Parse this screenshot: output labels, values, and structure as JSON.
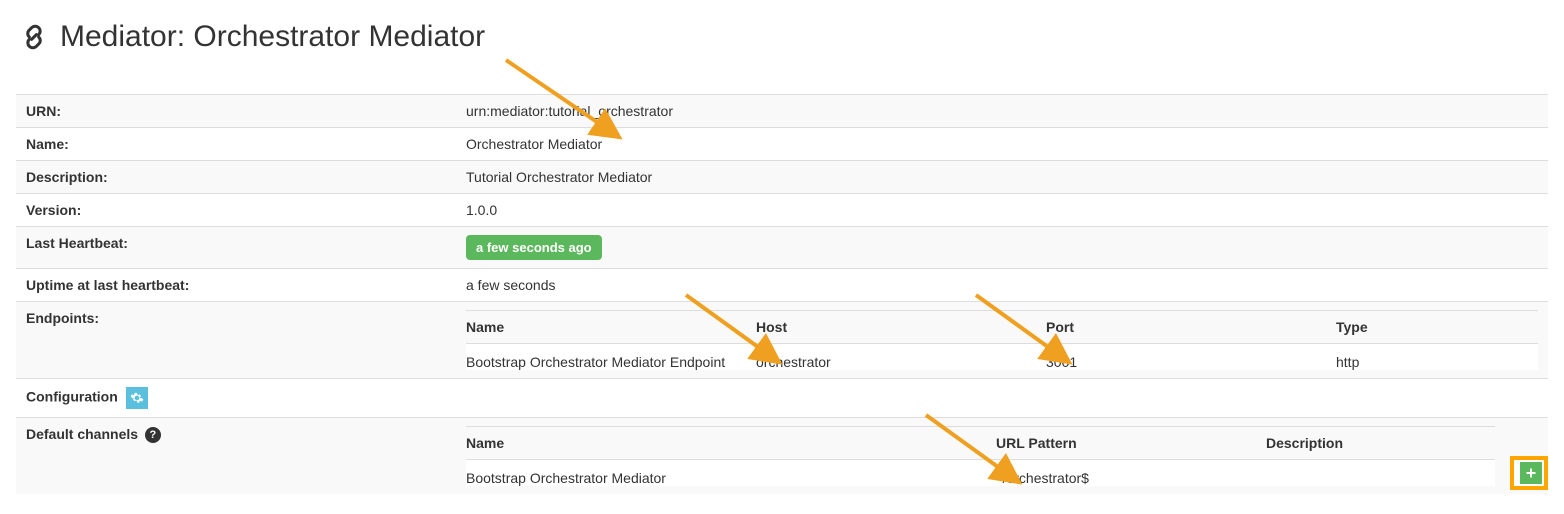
{
  "header": {
    "title": "Mediator: Orchestrator Mediator"
  },
  "labels": {
    "urn": "URN:",
    "name": "Name:",
    "description": "Description:",
    "version": "Version:",
    "lastHeartbeat": "Last Heartbeat:",
    "uptime": "Uptime at last heartbeat:",
    "endpoints": "Endpoints:",
    "configuration": "Configuration",
    "defaultChannels": "Default channels"
  },
  "values": {
    "urn": "urn:mediator:tutorial_orchestrator",
    "name": "Orchestrator Mediator",
    "description": "Tutorial Orchestrator Mediator",
    "version": "1.0.0",
    "lastHeartbeat": "a few seconds ago",
    "uptime": "a few seconds"
  },
  "endpoints": {
    "headers": {
      "name": "Name",
      "host": "Host",
      "port": "Port",
      "type": "Type"
    },
    "rows": [
      {
        "name": "Bootstrap Orchestrator Mediator Endpoint",
        "host": "orchestrator",
        "port": "3001",
        "type": "http"
      }
    ]
  },
  "channels": {
    "headers": {
      "name": "Name",
      "urlPattern": "URL Pattern",
      "description": "Description"
    },
    "rows": [
      {
        "name": "Bootstrap Orchestrator Mediator",
        "urlPattern": "^/orchestrator$",
        "description": ""
      }
    ]
  },
  "annotations": {
    "arrowColor": "#f0a020",
    "addButtonHighlight": "orange"
  }
}
